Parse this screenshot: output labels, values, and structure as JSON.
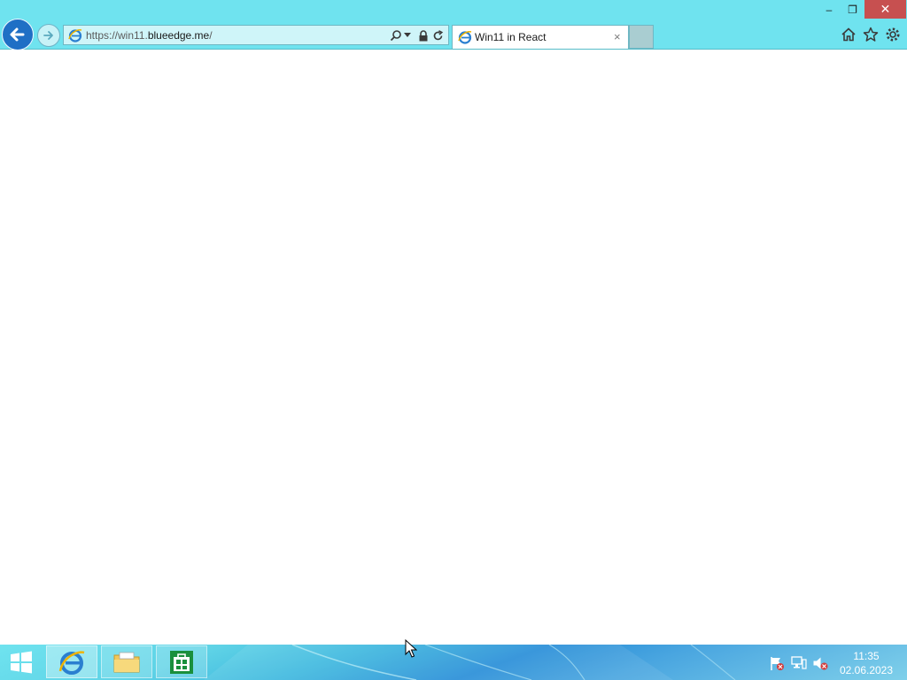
{
  "window_controls": {
    "minimize": "–",
    "restore": "❐",
    "close": "✕"
  },
  "navigation": {
    "back": "back-arrow-icon",
    "forward": "forward-arrow-icon"
  },
  "address_bar": {
    "url_prefix": "https://win11.",
    "url_domain": "blueedge.me",
    "url_suffix": "/",
    "icons": [
      "search-icon",
      "dropdown-icon",
      "lock-icon",
      "refresh-icon"
    ]
  },
  "tabs": [
    {
      "title": "Win11 in React",
      "close": "×",
      "active": true
    }
  ],
  "toolbar": {
    "icons": [
      "home-icon",
      "favorites-icon",
      "settings-icon"
    ]
  },
  "taskbar": {
    "pinned_apps": [
      "Internet Explorer",
      "File Explorer",
      "Store"
    ],
    "tray_icons": [
      "action-center-flag-icon",
      "network-icon",
      "volume-muted-icon"
    ],
    "clock": {
      "time": "11:35",
      "date": "02.06.2023"
    }
  },
  "colors": {
    "titlebar": "#6fe3ef",
    "close_button": "#c75050",
    "back_button": "#1f6fc5",
    "taskbar_accent": "#2a8fd8"
  }
}
